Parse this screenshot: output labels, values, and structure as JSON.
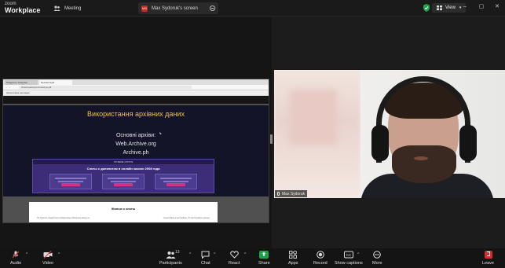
{
  "titlebar": {
    "app_line1": "zoom",
    "app_line2": "Workplace",
    "tab_meeting": "Meeting",
    "tab_screen": "Max Sydoruk's screen",
    "view_label": "View"
  },
  "shared_screen": {
    "browser_tabs": [
      "Telegram | Telegram",
      "Презентація"
    ],
    "url": "/Downloads/prezentaciya.pdf",
    "bookmarks": "Імпортовані закладки",
    "slide_title": "Використання архівних даних",
    "slide_lines": [
      "Основні архіви:",
      "Web.Archive.org",
      "Archive.ph"
    ],
    "embed_bar": "ЛУЧШИЕ СЛОТЫ",
    "embed_heading": "Слоты с джекпотом в онлайн казино 2008 года",
    "page2_heading": "Жилья и слоты",
    "page2_text_left": "По просьбе людей были обнаружены обширные ввиду их",
    "page2_text_right": "Серый Ивон в настройках. По фотографии данных"
  },
  "participant": {
    "name": "Max Sydoruk"
  },
  "toolbar": {
    "audio": "Audio",
    "video": "Video",
    "participants": "Participants",
    "participants_count": "13",
    "chat": "Chat",
    "react": "React",
    "share": "Share",
    "apps": "Apps",
    "record": "Record",
    "captions": "Show captions",
    "more": "More",
    "leave": "Leave"
  },
  "colors": {
    "share_green": "#1aa34a",
    "leave_red": "#d92d2d",
    "record_red": "#c62828",
    "slide_title_gold": "#f1c232"
  }
}
